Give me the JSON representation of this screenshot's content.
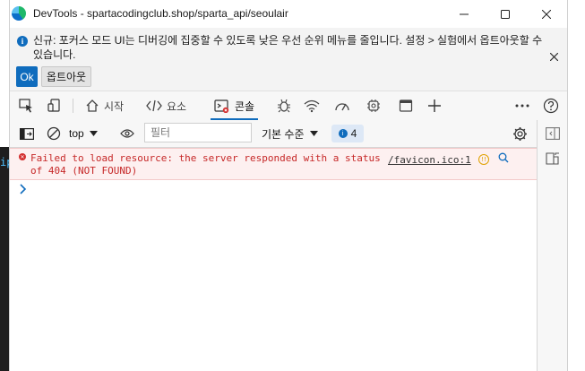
{
  "window": {
    "title": "DevTools - spartacodingclub.shop/sparta_api/seoulair",
    "minimize_icon": "minimize-icon",
    "maximize_icon": "maximize-icon",
    "close_icon": "close-icon"
  },
  "infobar": {
    "message": "신규: 포커스 모드 UI는 디버깅에 집중할 수 있도록 낮은 우선 순위 메뉴를 줄입니다. 설정 > 실험에서 옵트아웃할 수 있습니다.",
    "ok_label": "Ok",
    "optout_label": "옵트아웃"
  },
  "tabs": [
    {
      "label": "시작",
      "icon": "home-icon"
    },
    {
      "label": "요소",
      "icon": "code-icon"
    },
    {
      "label": "콘솔",
      "icon": "console-icon"
    }
  ],
  "toolbar": {
    "context": "top",
    "filter_placeholder": "필터",
    "levels_label": "기본 수준",
    "issues_count": "4"
  },
  "console": {
    "error_message": "Failed to load resource: the server responded with a status of 404 (NOT FOUND)",
    "error_source": "/favicon.ico:1"
  },
  "colors": {
    "accent": "#0f6cbd",
    "error_text": "#c62828",
    "error_bg": "#fdf0f0"
  }
}
